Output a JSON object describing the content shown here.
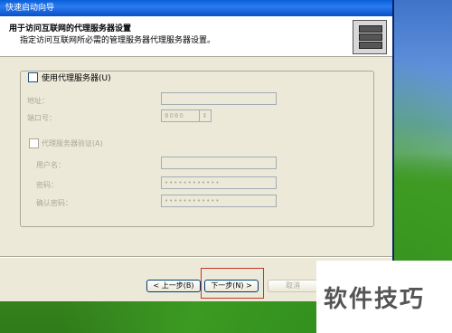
{
  "window": {
    "title": "快速启动向导",
    "header_title": "用于访问互联网的代理服务器设置",
    "header_subtitle": "指定访问互联网所必需的管理服务器代理服务器设置。"
  },
  "proxy": {
    "use_proxy_label": "使用代理服务器(U)",
    "use_proxy_checked": false,
    "address_label": "地址：",
    "port_label": "端口号：",
    "port_value": "8080",
    "auth_label": "代理服务器验证(A)",
    "auth_checked": false,
    "username_label": "用户名：",
    "password_label": "密码：",
    "confirm_password_label": "确认密码：",
    "password_value": "••••••••••••",
    "confirm_password_value": "••••••••••••"
  },
  "buttons": {
    "back": "< 上一步(B)",
    "next": "下一步(N) >",
    "cancel": "取消"
  },
  "watermark": {
    "text": "软件技巧"
  }
}
